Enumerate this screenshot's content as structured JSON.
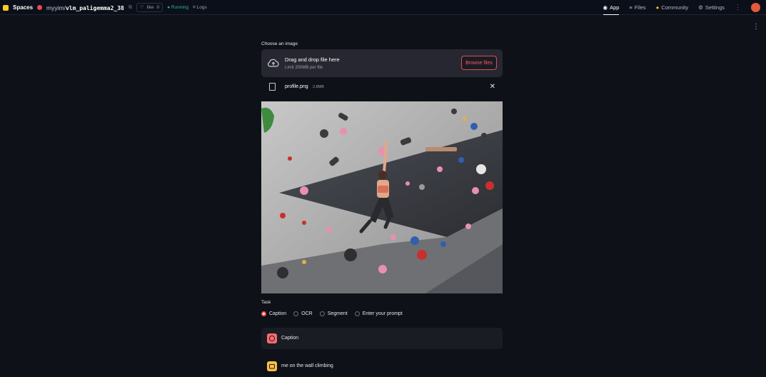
{
  "header": {
    "brand": "Spaces",
    "owner": "myyim",
    "repo": "vlm_paligemma2_38",
    "like_label": "like",
    "like_count": "0",
    "status": "Running",
    "logs_label": "Logs",
    "nav": [
      {
        "label": "App",
        "active": true
      },
      {
        "label": "Files",
        "active": false
      },
      {
        "label": "Community",
        "active": false
      },
      {
        "label": "Settings",
        "active": false
      }
    ]
  },
  "uploader": {
    "label": "Choose an image",
    "drop_title": "Drag and drop file here",
    "drop_limit": "Limit 200MB per file",
    "browse_label": "Browse files",
    "file_name": "profile.png",
    "file_size": "2.8MB"
  },
  "task": {
    "label": "Task",
    "options": [
      "Caption",
      "OCR",
      "Segment",
      "Enter your prompt"
    ],
    "selected": "Caption"
  },
  "chat": [
    {
      "role": "user",
      "text": "Caption"
    },
    {
      "role": "assistant",
      "text": "me on the wall climbing"
    }
  ],
  "colors": {
    "background": "#0e1117",
    "accent": "#ff4b4b",
    "running": "#2fb88f"
  }
}
